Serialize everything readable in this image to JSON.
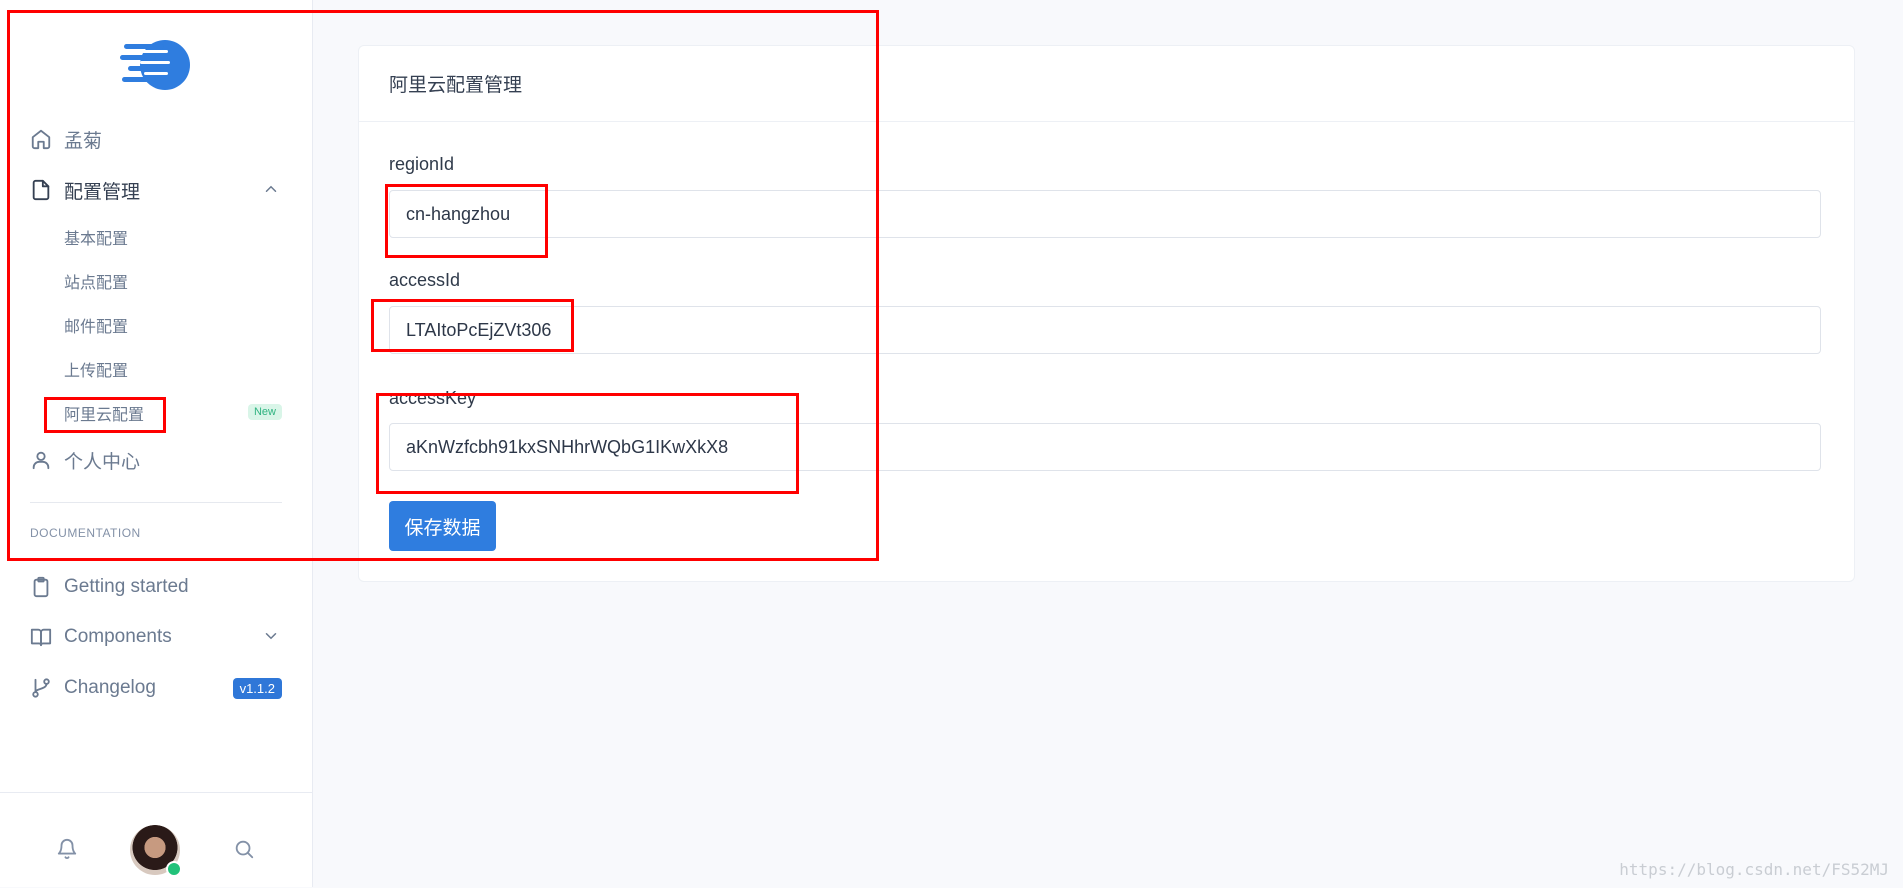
{
  "colors": {
    "accent": "#2f7ddf",
    "annotation": "#ff0000",
    "new_badge": "#2fb380"
  },
  "sidebar": {
    "logo_icon": "brand-logo-icon",
    "items": [
      {
        "label": "孟菊",
        "icon": "home-icon"
      },
      {
        "label": "配置管理",
        "icon": "file-icon",
        "expanded": true
      }
    ],
    "sub_items": [
      {
        "label": "基本配置"
      },
      {
        "label": "站点配置"
      },
      {
        "label": "邮件配置"
      },
      {
        "label": "上传配置"
      },
      {
        "label": "阿里云配置",
        "badge": "New"
      }
    ],
    "profile_item": {
      "label": "个人中心",
      "icon": "user-icon"
    },
    "section_label": "DOCUMENTATION",
    "docs": [
      {
        "label": "Getting started",
        "icon": "clipboard-icon"
      },
      {
        "label": "Components",
        "icon": "book-icon"
      },
      {
        "label": "Changelog",
        "icon": "git-branch-icon",
        "badge": "v1.1.2"
      }
    ],
    "footer_icons": [
      "bell-icon",
      "avatar",
      "search-icon"
    ]
  },
  "card": {
    "title": "阿里云配置管理",
    "fields": [
      {
        "label": "regionId",
        "value": "cn-hangzhou"
      },
      {
        "label": "accessId",
        "value": "LTAItoPcEjZVt306"
      },
      {
        "label": "accessKey",
        "value": "aKnWzfcbh91kxSNHhrWQbG1IKwXkX8"
      }
    ],
    "save_label": "保存数据"
  },
  "watermark": "https://blog.csdn.net/FS52MJ"
}
